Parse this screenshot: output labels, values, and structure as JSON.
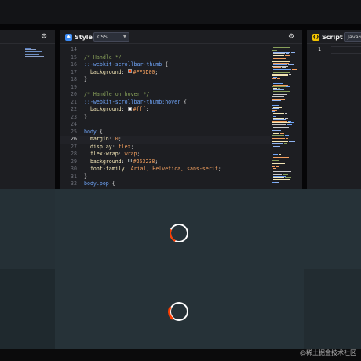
{
  "colors": {
    "accent": "#FF3D00",
    "preview_bg": "#263238",
    "style_badge": "#3b8bf5",
    "script_badge": "#f2c200"
  },
  "panels": {
    "left": {
      "settings_icon": "gear-icon"
    },
    "style": {
      "title": "Style",
      "badge_icon": "css-badge-icon",
      "language": "CSS",
      "settings_icon": "gear-icon",
      "code": [
        {
          "n": "14",
          "parts": []
        },
        {
          "n": "15",
          "parts": [
            [
              "c-comment",
              "/* Handle */"
            ]
          ]
        },
        {
          "n": "16",
          "parts": [
            [
              "c-sel",
              "::-webkit-scrollbar-thumb"
            ],
            [
              "c-punc",
              " {"
            ]
          ]
        },
        {
          "n": "17",
          "parts": [
            [
              "c-prop",
              "  background"
            ],
            [
              "c-punc",
              ": "
            ],
            [
              "swatch",
              "#FF3D00"
            ],
            [
              "c-val",
              "#FF3D00"
            ],
            [
              "c-punc",
              ";"
            ]
          ]
        },
        {
          "n": "18",
          "parts": [
            [
              "c-punc",
              "}"
            ]
          ]
        },
        {
          "n": "19",
          "parts": []
        },
        {
          "n": "20",
          "parts": [
            [
              "c-comment",
              "/* Handle on hover */"
            ]
          ]
        },
        {
          "n": "21",
          "parts": [
            [
              "c-sel",
              "::-webkit-scrollbar-thumb:hover"
            ],
            [
              "c-punc",
              " {"
            ]
          ]
        },
        {
          "n": "22",
          "parts": [
            [
              "c-prop",
              "  background"
            ],
            [
              "c-punc",
              ": "
            ],
            [
              "swatch",
              "#fff"
            ],
            [
              "c-val",
              "#fff"
            ],
            [
              "c-punc",
              ";"
            ]
          ]
        },
        {
          "n": "23",
          "parts": [
            [
              "c-punc",
              "}"
            ]
          ]
        },
        {
          "n": "24",
          "parts": []
        },
        {
          "n": "25",
          "parts": [
            [
              "c-sel",
              "body"
            ],
            [
              "c-punc",
              " {"
            ]
          ]
        },
        {
          "n": "26",
          "active": true,
          "parts": [
            [
              "c-prop",
              "  margin"
            ],
            [
              "c-punc",
              ": "
            ],
            [
              "c-val",
              "0"
            ],
            [
              "c-punc",
              ";"
            ]
          ]
        },
        {
          "n": "27",
          "parts": [
            [
              "c-prop",
              "  display"
            ],
            [
              "c-punc",
              ": "
            ],
            [
              "c-val",
              "flex"
            ],
            [
              "c-punc",
              ";"
            ]
          ]
        },
        {
          "n": "28",
          "parts": [
            [
              "c-prop",
              "  flex-wrap"
            ],
            [
              "c-punc",
              ": "
            ],
            [
              "c-val",
              "wrap"
            ],
            [
              "c-punc",
              ";"
            ]
          ]
        },
        {
          "n": "29",
          "parts": [
            [
              "c-prop",
              "  background"
            ],
            [
              "c-punc",
              ": "
            ],
            [
              "swatch",
              "#263238"
            ],
            [
              "c-val",
              "#263238"
            ],
            [
              "c-punc",
              ";"
            ]
          ]
        },
        {
          "n": "30",
          "parts": [
            [
              "c-prop",
              "  font-family"
            ],
            [
              "c-punc",
              ": "
            ],
            [
              "c-val",
              "Arial, Helvetica, sans-serif"
            ],
            [
              "c-punc",
              ";"
            ]
          ]
        },
        {
          "n": "31",
          "parts": [
            [
              "c-punc",
              "}"
            ]
          ]
        },
        {
          "n": "32",
          "parts": [
            [
              "c-sel",
              "body.pop"
            ],
            [
              "c-punc",
              " {"
            ]
          ]
        }
      ]
    },
    "script": {
      "title": "Script",
      "badge_icon": "js-badge-icon",
      "language": "JavaSc",
      "line_numbers": [
        "1"
      ]
    }
  },
  "preview": {
    "loaders": [
      {
        "name": "loader-1"
      },
      {
        "name": "loader-2"
      }
    ]
  },
  "watermark": "@稀土掘金技术社区"
}
